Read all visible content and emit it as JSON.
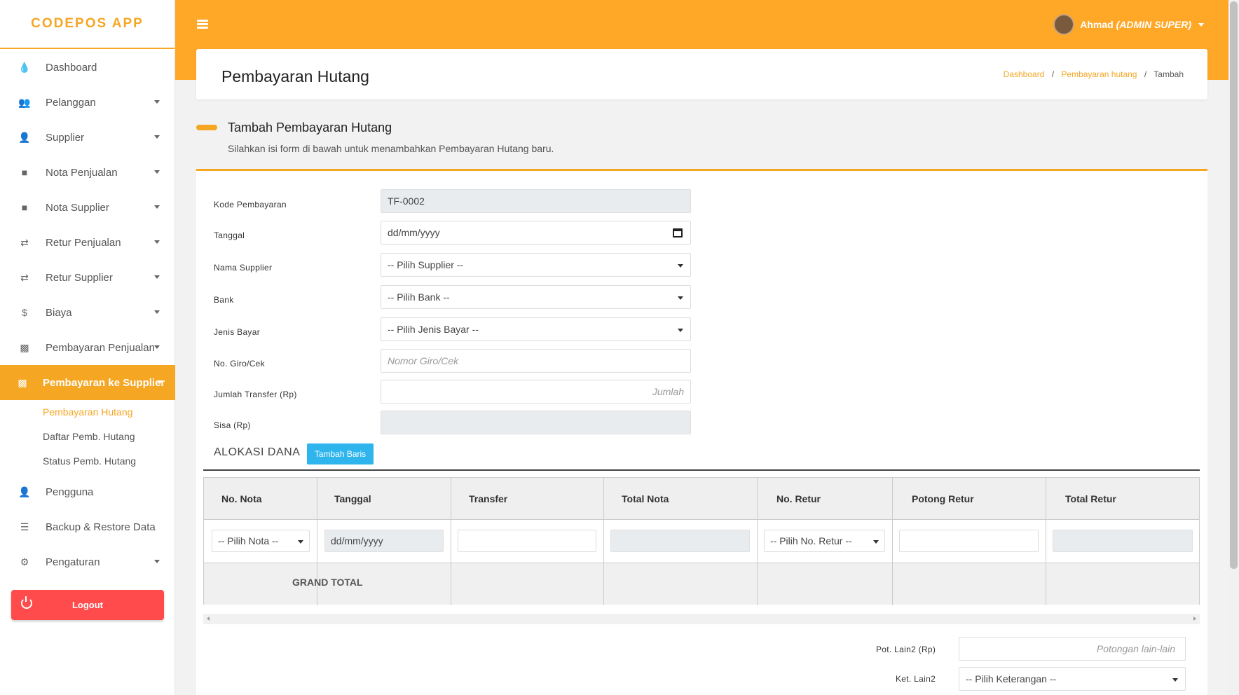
{
  "app": {
    "brand": "CODEPOS APP"
  },
  "topbar": {
    "user_name": "Ahmad",
    "user_role": "(ADMIN SUPER)"
  },
  "sidebar": {
    "items": [
      {
        "label": "Dashboard",
        "icon": "fire-icon"
      },
      {
        "label": "Pelanggan",
        "icon": "users-icon"
      },
      {
        "label": "Supplier",
        "icon": "user-tie-icon"
      },
      {
        "label": "Nota Penjualan",
        "icon": "sticky-note-icon"
      },
      {
        "label": "Nota Supplier",
        "icon": "sticky-note-icon"
      },
      {
        "label": "Retur Penjualan",
        "icon": "exchange-icon"
      },
      {
        "label": "Retur Supplier",
        "icon": "exchange-icon"
      },
      {
        "label": "Biaya",
        "icon": "dollar-icon"
      },
      {
        "label": "Pembayaran Penjualan",
        "icon": "money-icon"
      },
      {
        "label": "Pembayaran ke Supplier",
        "icon": "money-icon"
      },
      {
        "label": "Pengguna",
        "icon": "user-icon"
      },
      {
        "label": "Backup & Restore Data",
        "icon": "database-icon"
      },
      {
        "label": "Pengaturan",
        "icon": "cogs-icon"
      }
    ],
    "submenu": [
      {
        "label": "Pembayaran Hutang"
      },
      {
        "label": "Daftar Pemb. Hutang"
      },
      {
        "label": "Status Pemb. Hutang"
      }
    ],
    "logout_label": "Logout"
  },
  "header": {
    "title": "Pembayaran Hutang",
    "breadcrumb": [
      "Dashboard",
      "Pembayaran hutang",
      "Tambah"
    ],
    "breadcrumb_sep": "/"
  },
  "section": {
    "title": "Tambah Pembayaran Hutang",
    "subtitle": "Silahkan isi form di bawah untuk menambahkan Pembayaran Hutang baru."
  },
  "form": {
    "kode": {
      "label": "Kode Pembayaran",
      "value": "TF-0002"
    },
    "tanggal": {
      "label": "Tanggal",
      "value": "dd/mm/yyyy"
    },
    "supplier": {
      "label": "Nama Supplier",
      "value": "-- Pilih Supplier --"
    },
    "bank": {
      "label": "Bank",
      "value": "-- Pilih Bank --"
    },
    "jenis": {
      "label": "Jenis Bayar",
      "value": "-- Pilih Jenis Bayar --"
    },
    "giro": {
      "label": "No. Giro/Cek",
      "placeholder": "Nomor Giro/Cek"
    },
    "jumlah": {
      "label": "Jumlah Transfer (Rp)",
      "placeholder": "Jumlah"
    },
    "sisa": {
      "label": "Sisa (Rp)",
      "value": ""
    }
  },
  "alokasi": {
    "title": "ALOKASI DANA",
    "add_row_label": "Tambah Baris",
    "columns": [
      "No. Nota",
      "Tanggal",
      "Transfer",
      "Total Nota",
      "No. Retur",
      "Potong Retur",
      "Total Retur"
    ],
    "row": {
      "no_nota": "-- Pilih Nota --",
      "tanggal": "dd/mm/yyyy",
      "no_retur": "-- Pilih No. Retur --"
    },
    "grand_total_label": "GRAND TOTAL"
  },
  "bottom": {
    "pot_lain_label": "Pot. Lain2 (Rp)",
    "pot_lain_placeholder": "Potongan lain-lain",
    "ket_lain_label": "Ket. Lain2",
    "ket_lain_value": "-- Pilih Keterangan --"
  },
  "colors": {
    "accent": "#ffa726",
    "logout": "#ff4b4b",
    "info": "#2fb5ee"
  }
}
